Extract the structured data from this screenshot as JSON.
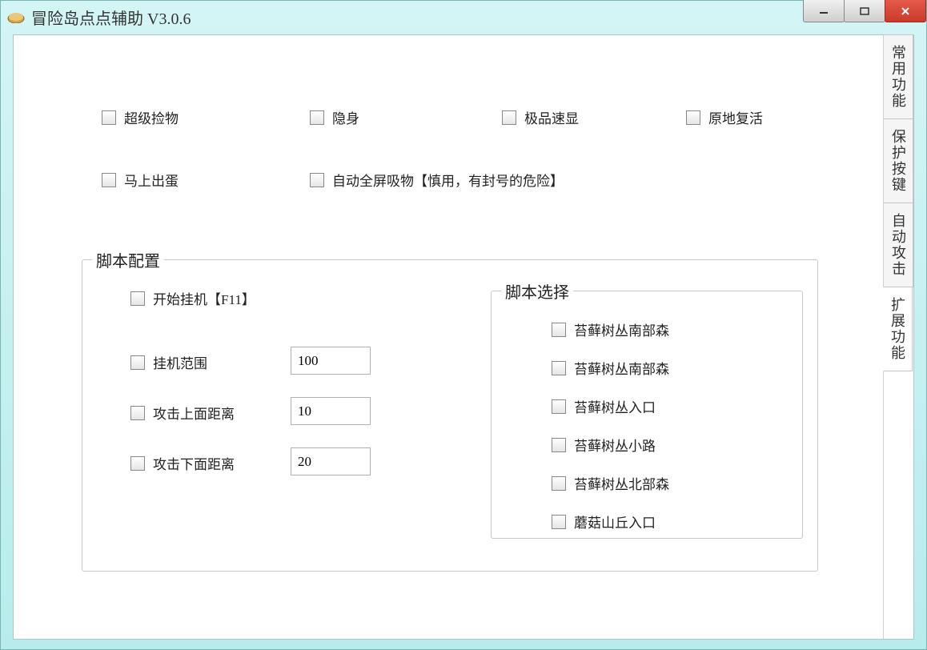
{
  "window": {
    "title": "冒险岛点点辅助 V3.0.6"
  },
  "tabs": {
    "t1": "常用功能",
    "t2": "保护按键",
    "t3": "自动攻击",
    "t4": "扩展功能"
  },
  "top_checks": {
    "super_pickup": "超级捡物",
    "invisibility": "隐身",
    "quality_show": "极品速显",
    "revive_inplace": "原地复活",
    "egg_now": "马上出蛋",
    "fullscreen_suck": "自动全屏吸物【慎用，有封号的危险】"
  },
  "script_config": {
    "legend": "脚本配置",
    "start_afk": "开始挂机【F11】",
    "afk_range_label": "挂机范围",
    "afk_range_value": "100",
    "atk_up_label": "攻击上面距离",
    "atk_up_value": "10",
    "atk_down_label": "攻击下面距离",
    "atk_down_value": "20"
  },
  "script_select": {
    "legend": "脚本选择",
    "items": {
      "s1": "苔藓树丛南部森",
      "s2": "苔藓树丛南部森",
      "s3": "苔藓树丛入口",
      "s4": "苔藓树丛小路",
      "s5": "苔藓树丛北部森",
      "s6": "蘑菇山丘入口"
    }
  }
}
